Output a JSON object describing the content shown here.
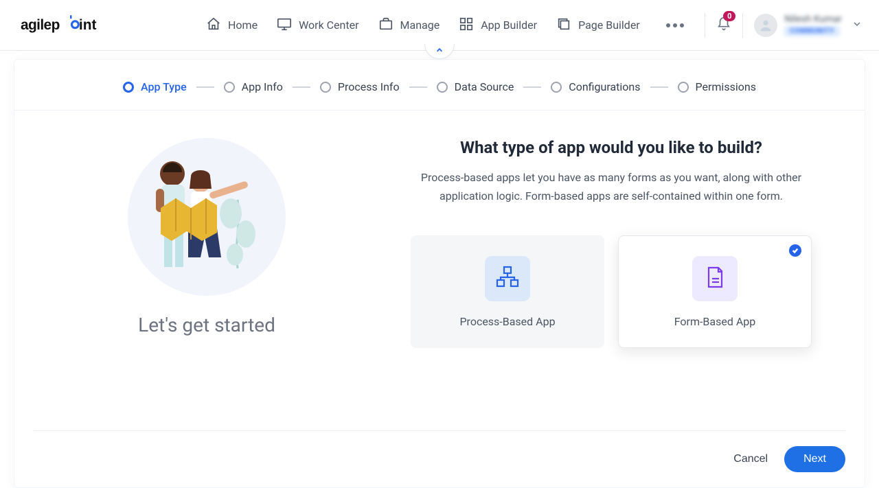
{
  "brand": {
    "name": "agilepoint"
  },
  "nav": {
    "items": [
      {
        "label": "Home"
      },
      {
        "label": "Work Center"
      },
      {
        "label": "Manage"
      },
      {
        "label": "App Builder"
      },
      {
        "label": "Page Builder"
      }
    ],
    "notification_count": "0",
    "user_name": "Nilesh Kumar",
    "user_tag": "COMMUNITY"
  },
  "wizard_steps": [
    {
      "label": "App Type",
      "active": true
    },
    {
      "label": "App Info"
    },
    {
      "label": "Process Info"
    },
    {
      "label": "Data Source"
    },
    {
      "label": "Configurations"
    },
    {
      "label": "Permissions"
    }
  ],
  "left": {
    "heading": "Let's get started"
  },
  "main": {
    "title": "What type of app would you like to build?",
    "subtitle": "Process-based apps let you have as many forms as you want, along with other application logic. Form-based apps are self-contained within one form.",
    "options": [
      {
        "label": "Process-Based App",
        "selected": false
      },
      {
        "label": "Form-Based App",
        "selected": true
      }
    ]
  },
  "footer": {
    "cancel": "Cancel",
    "next": "Next"
  }
}
